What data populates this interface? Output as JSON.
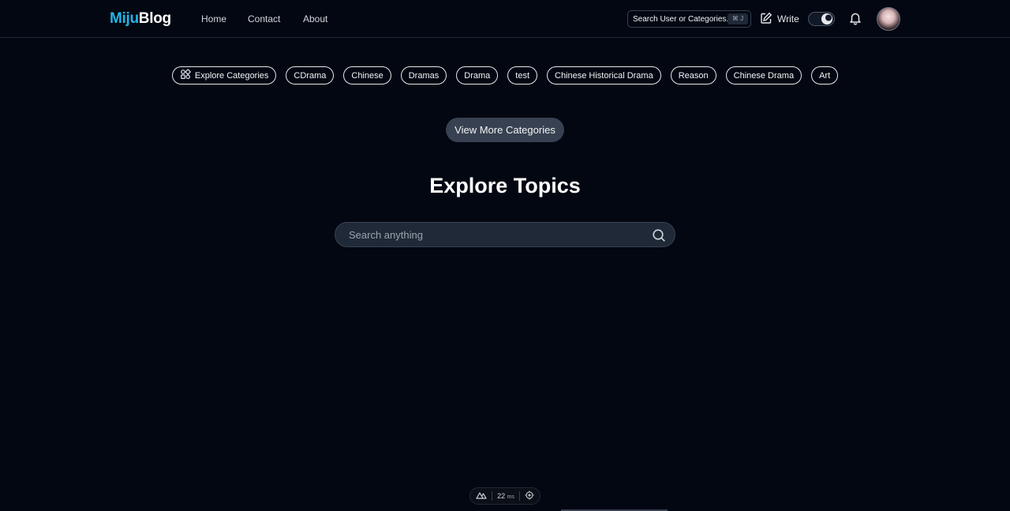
{
  "header": {
    "logo_part1": "Miju",
    "logo_part2": "Blog",
    "nav": [
      "Home",
      "Contact",
      "About"
    ],
    "search_label": "Search User or Categories...",
    "search_shortcut": "⌘ J",
    "write_label": "Write"
  },
  "categories": {
    "explore_label": "Explore Categories",
    "items": [
      "CDrama",
      "Chinese",
      "Dramas",
      "Drama",
      "test",
      "Chinese Historical Drama",
      "Reason",
      "Chinese Drama",
      "Art"
    ],
    "view_more_label": "View More Categories"
  },
  "main": {
    "title": "Explore Topics",
    "search_placeholder": "Search anything"
  },
  "devbar": {
    "time": "22",
    "unit": "ms"
  },
  "colors": {
    "background": "#030712",
    "brand_accent": "#1fb5e8",
    "surface": "#1f2937"
  }
}
